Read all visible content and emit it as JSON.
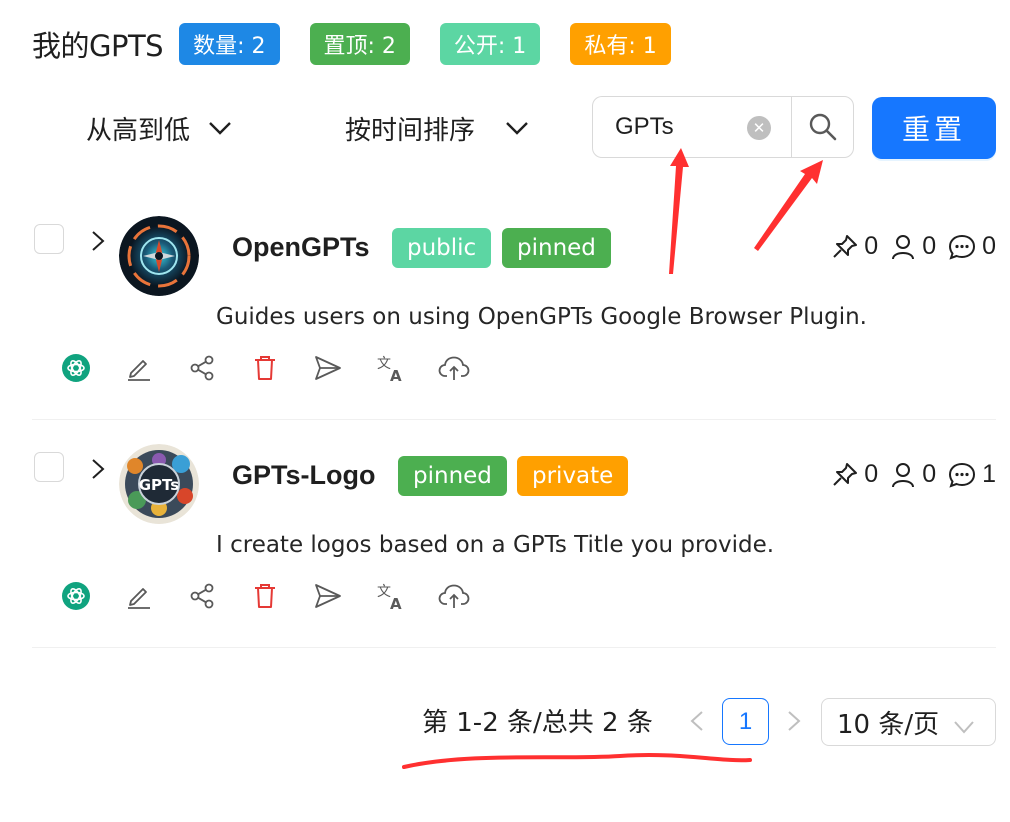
{
  "header": {
    "title": "我的GPTS",
    "stats": [
      {
        "label": "数量: 2",
        "color": "#1e88e5"
      },
      {
        "label": "置顶: 2",
        "color": "#4caf50"
      },
      {
        "label": "公开: 1",
        "color": "#5cd6a3"
      },
      {
        "label": "私有: 1",
        "color": "#ffa000"
      }
    ]
  },
  "toolbar": {
    "sort_order": "从高到低",
    "sort_by": "按时间排序",
    "search_value": "GPTs",
    "reset_label": "重置"
  },
  "items": [
    {
      "name": "OpenGPTs",
      "tags": [
        {
          "label": "public",
          "color": "#5cd6a3"
        },
        {
          "label": "pinned",
          "color": "#4caf50"
        }
      ],
      "pins": "0",
      "users": "0",
      "comments": "0",
      "description": "Guides users on using OpenGPTs Google Browser Plugin."
    },
    {
      "name": "GPTs-Logo",
      "tags": [
        {
          "label": "pinned",
          "color": "#4caf50"
        },
        {
          "label": "private",
          "color": "#ffa000"
        }
      ],
      "pins": "0",
      "users": "0",
      "comments": "1",
      "description": "I create logos based on a GPTs Title you provide.",
      "avatar_text": "GPTs"
    }
  ],
  "pagination": {
    "total_text": "第 1-2 条/总共 2 条",
    "current_page": "1",
    "page_size": "10 条/页"
  },
  "colors": {
    "primary": "#1677ff",
    "openai_green": "#10a37f",
    "delete_red": "#e53935",
    "annotation_red": "#ff3030"
  }
}
